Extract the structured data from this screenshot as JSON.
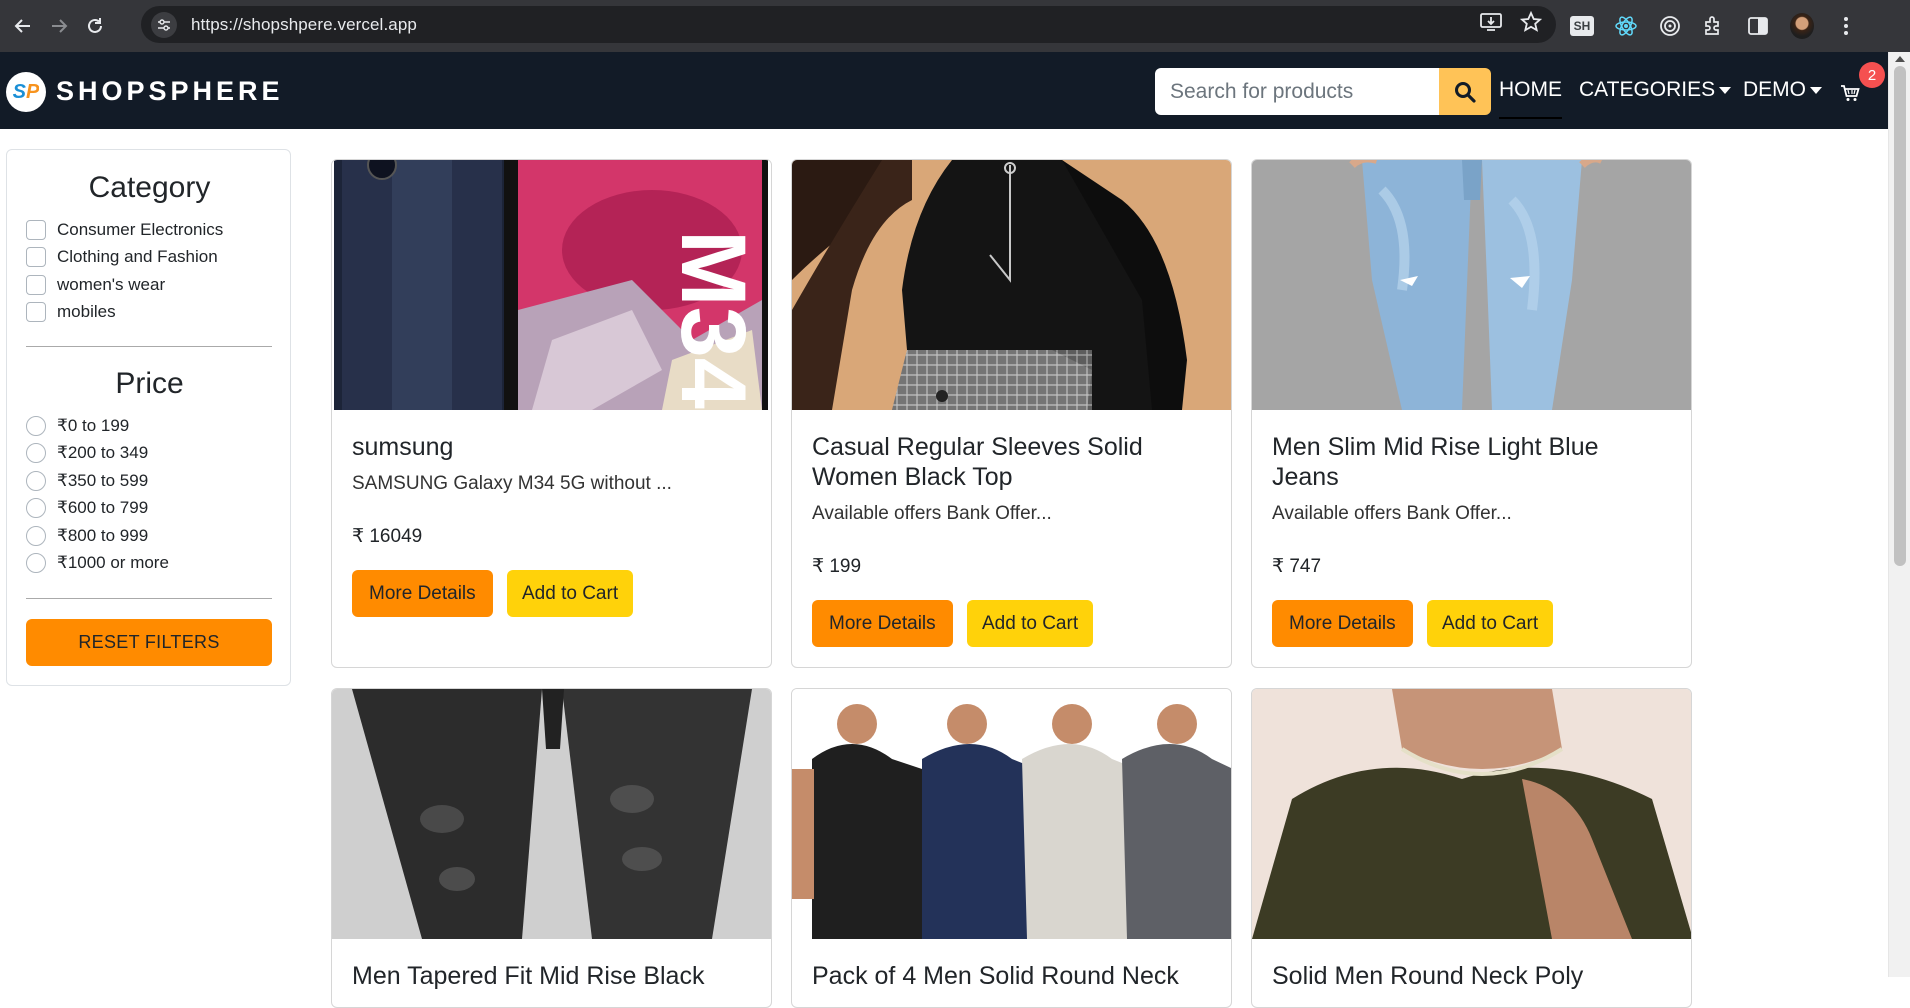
{
  "browser": {
    "url": "https://shopshpere.vercel.app",
    "extension_badge": "SH"
  },
  "navbar": {
    "logo_text": "SP",
    "brand": "SHOPSPHERE",
    "search_placeholder": "Search for products",
    "home": "HOME",
    "categories": "CATEGORIES",
    "demo": "DEMO",
    "cart_count": "2"
  },
  "filters": {
    "category_heading": "Category",
    "categories": [
      "Consumer Electronics",
      "Clothing and Fashion",
      "women's wear",
      "mobiles"
    ],
    "price_heading": "Price",
    "prices": [
      "₹0 to 199",
      "₹200 to 349",
      "₹350 to 599",
      "₹600 to 799",
      "₹800 to 999",
      "₹1000 or more"
    ],
    "reset_label": "RESET FILTERS"
  },
  "products": [
    {
      "title": "sumsung",
      "desc": "SAMSUNG Galaxy M34 5G without ...",
      "price": "₹ 16049",
      "more": "More Details",
      "add": "Add to Cart"
    },
    {
      "title": "Casual Regular Sleeves Solid Women Black Top",
      "desc": "Available offers Bank Offer...",
      "price": "₹ 199",
      "more": "More Details",
      "add": "Add to Cart"
    },
    {
      "title": "Men Slim Mid Rise Light Blue Jeans",
      "desc": "Available offers Bank Offer...",
      "price": "₹ 747",
      "more": "More Details",
      "add": "Add to Cart"
    },
    {
      "title": "Men Tapered Fit Mid Rise Black"
    },
    {
      "title": "Pack of 4 Men Solid Round Neck"
    },
    {
      "title": "Solid Men Round Neck Poly"
    }
  ]
}
